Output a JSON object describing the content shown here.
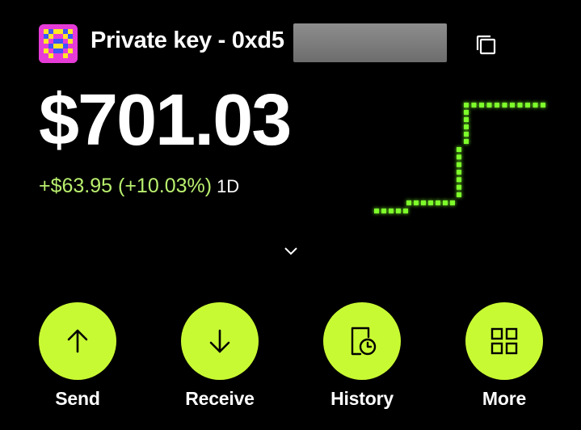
{
  "account": {
    "name": "Private key - 0xd5",
    "avatar_icon": "pixel-identicon"
  },
  "balance": {
    "amount": "$701.03",
    "change": "+$63.95 (+10.03%)",
    "period": "1D"
  },
  "colors": {
    "accent": "#c8fa34",
    "gain": "#b9ef6e",
    "chart": "#7dff2a",
    "background": "#000000"
  },
  "actions": [
    {
      "label": "Send",
      "icon": "arrow-up-icon"
    },
    {
      "label": "Receive",
      "icon": "arrow-down-icon"
    },
    {
      "label": "History",
      "icon": "history-icon"
    },
    {
      "label": "More",
      "icon": "grid-icon"
    }
  ]
}
